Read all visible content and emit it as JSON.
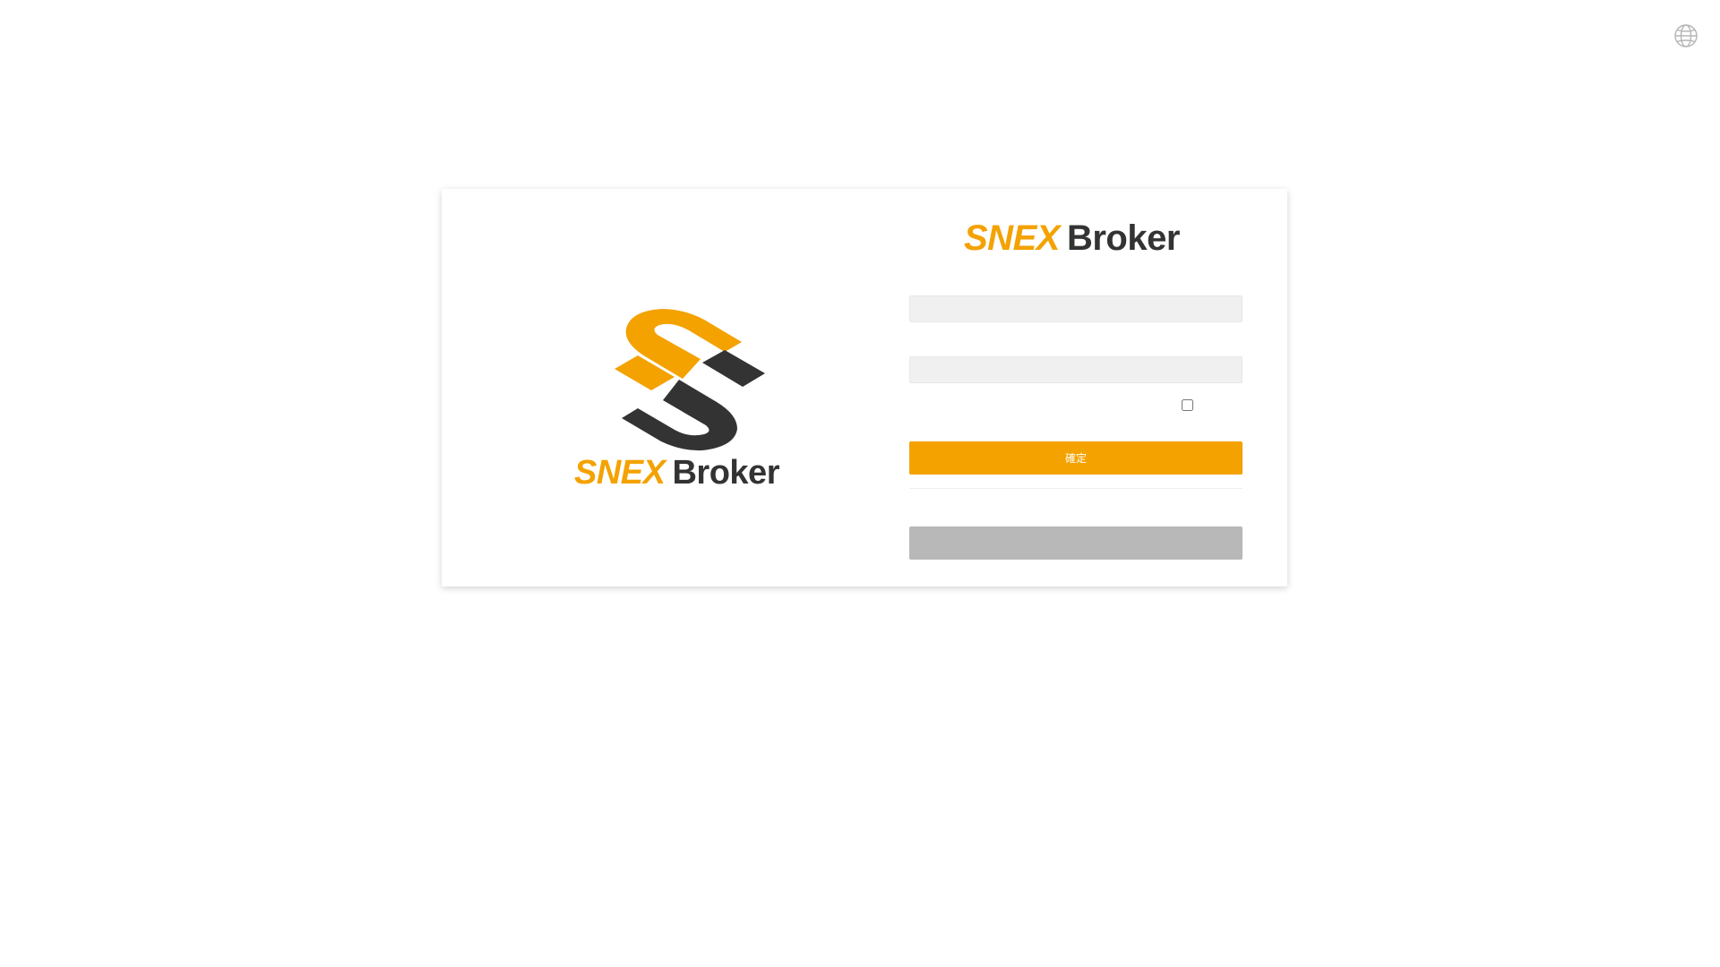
{
  "brand": {
    "snex": "SNEX",
    "broker": "Broker",
    "accent_color": "#f3a200",
    "dark_color": "#333333"
  },
  "header": {
    "language_icon": "globe-icon"
  },
  "login": {
    "username_value": "",
    "password_value": "",
    "remember_checked": false,
    "confirm_label": "確定",
    "secondary_label": ""
  }
}
